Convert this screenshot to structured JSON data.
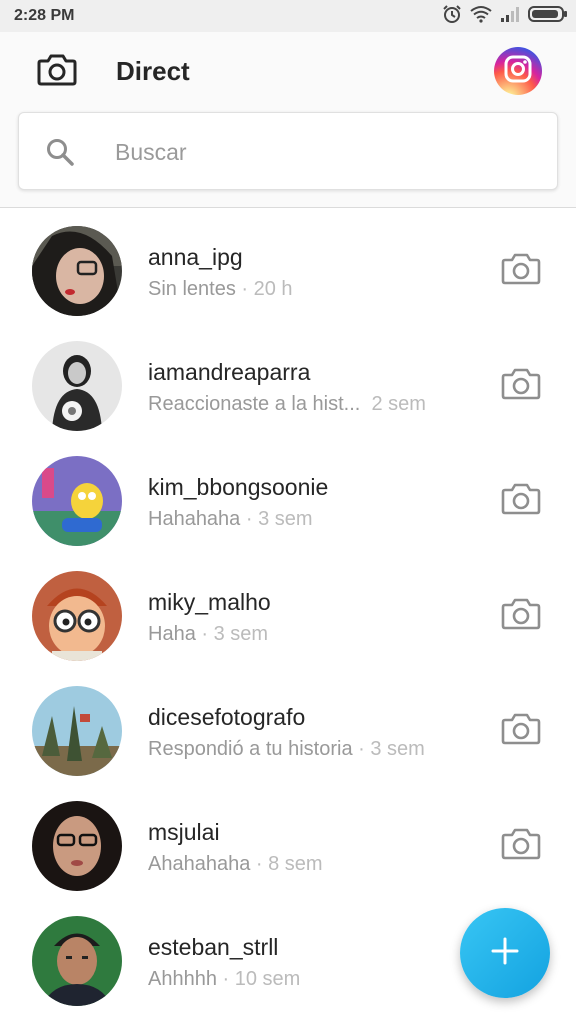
{
  "status_bar": {
    "time": "2:28 PM"
  },
  "header": {
    "title": "Direct"
  },
  "search": {
    "placeholder": "Buscar"
  },
  "conversations": [
    {
      "username": "anna_ipg",
      "preview": "Sin lentes",
      "separator": " · ",
      "time": "20 h"
    },
    {
      "username": "iamandreaparra",
      "preview": "Reaccionaste a la hist...",
      "separator": "  ",
      "time": "2 sem"
    },
    {
      "username": "kim_bbongsoonie",
      "preview": "Hahahaha",
      "separator": " · ",
      "time": "3 sem"
    },
    {
      "username": "miky_malho",
      "preview": "Haha",
      "separator": " · ",
      "time": "3 sem"
    },
    {
      "username": "dicesefotografo",
      "preview": "Respondió a tu historia",
      "separator": " · ",
      "time": "3 sem"
    },
    {
      "username": "msjulai",
      "preview": "Ahahahaha",
      "separator": " · ",
      "time": "8 sem"
    },
    {
      "username": "esteban_strll",
      "preview": "Ahhhhh",
      "separator": " · ",
      "time": "10 sem"
    }
  ],
  "icons": {
    "status": [
      "alarm-icon",
      "wifi-icon",
      "signal-icon",
      "battery-icon"
    ],
    "header_left": "camera-icon",
    "header_right": "instagram-icon",
    "search": "search-icon",
    "row_action": "camera-icon",
    "fab": "plus-icon"
  },
  "colors": {
    "accent": "#1ea7e4",
    "secondary_text": "#999999",
    "header_bg": "#fafafa"
  }
}
